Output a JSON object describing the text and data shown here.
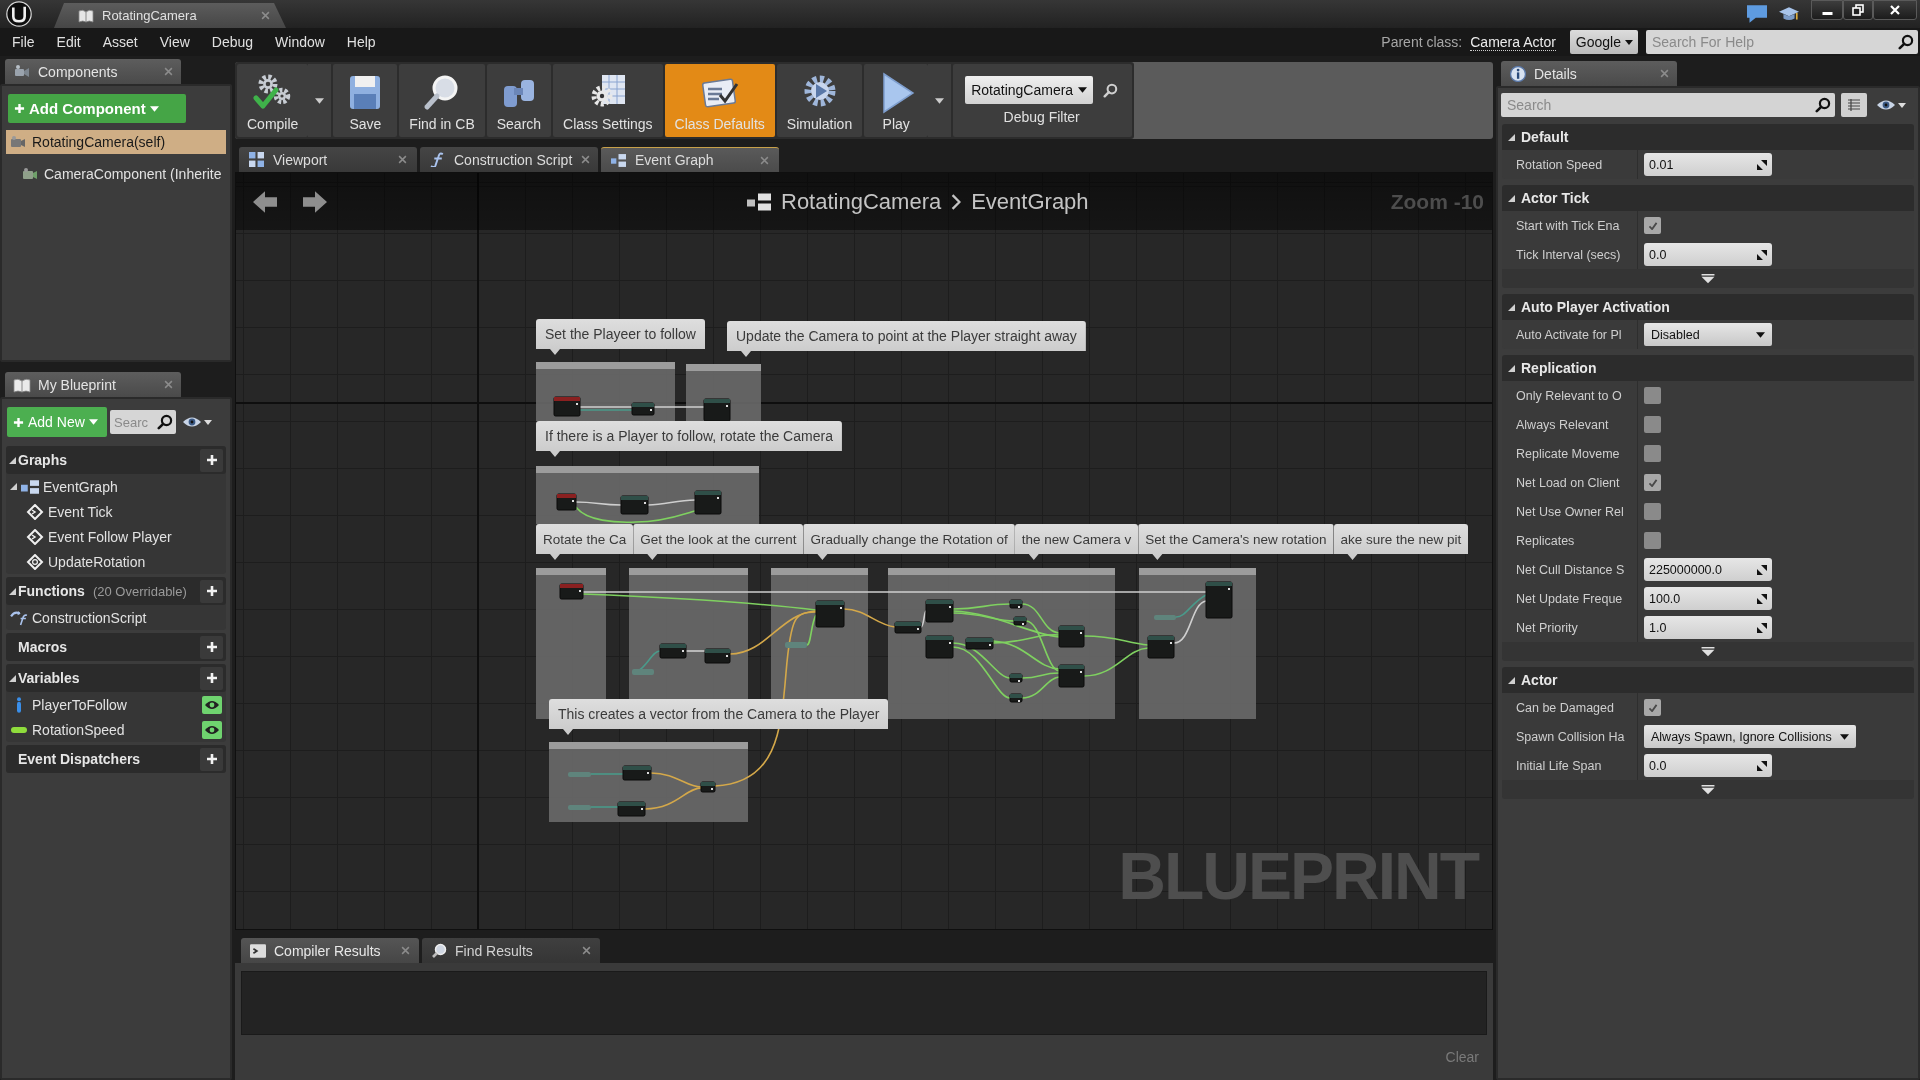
{
  "title_bar": {
    "document_tab": "RotatingCamera"
  },
  "menu_bar": {
    "menus": [
      "File",
      "Edit",
      "Asset",
      "View",
      "Debug",
      "Window",
      "Help"
    ],
    "parent_class_label": "Parent class:",
    "parent_class": "Camera Actor",
    "search_provider": "Google",
    "help_search": {
      "placeholder": "Search For Help"
    }
  },
  "components_panel": {
    "tab": "Components",
    "add_button": "Add Component",
    "items": [
      {
        "label": "RotatingCamera(self)",
        "selected": true
      },
      {
        "label": "CameraComponent (Inherite",
        "selected": false
      }
    ]
  },
  "my_blueprint_panel": {
    "tab": "My Blueprint",
    "add_button": "Add New",
    "search": {
      "placeholder": "Searc"
    },
    "sections": [
      {
        "title": "Graphs",
        "items": [
          {
            "label": "EventGraph",
            "kind": "graph",
            "expanded": true,
            "children": [
              {
                "label": "Event Tick",
                "kind": "event"
              },
              {
                "label": "Event Follow Player",
                "kind": "event"
              },
              {
                "label": "UpdateRotation",
                "kind": "custom_event"
              }
            ]
          }
        ]
      },
      {
        "title": "Functions",
        "note": "(20 Overridable)",
        "items": [
          {
            "label": "ConstructionScript",
            "kind": "function"
          }
        ]
      },
      {
        "title": "Macros"
      },
      {
        "title": "Variables",
        "items": [
          {
            "label": "PlayerToFollow",
            "kind": "object",
            "public": true
          },
          {
            "label": "RotationSpeed",
            "kind": "float",
            "public": true
          }
        ]
      },
      {
        "title": "Event Dispatchers"
      }
    ]
  },
  "toolbar": {
    "buttons": [
      {
        "label": "Compile",
        "selected": false,
        "dropdown": true
      },
      {
        "label": "Save",
        "selected": false,
        "dropdown": false
      },
      {
        "label": "Find in CB",
        "selected": false,
        "dropdown": false
      },
      {
        "label": "Search",
        "selected": false,
        "dropdown": false
      },
      {
        "label": "Class Settings",
        "selected": false,
        "dropdown": false
      },
      {
        "label": "Class Defaults",
        "selected": true,
        "dropdown": false
      },
      {
        "label": "Simulation",
        "selected": false,
        "dropdown": false
      },
      {
        "label": "Play",
        "selected": false,
        "dropdown": true
      }
    ],
    "debug_filter": {
      "value": "RotatingCamera",
      "label": "Debug Filter"
    }
  },
  "editor_tabs": [
    {
      "label": "Viewport",
      "selected": false
    },
    {
      "label": "Construction Script",
      "selected": false
    },
    {
      "label": "Event Graph",
      "selected": true
    }
  ],
  "graph": {
    "breadcrumb": [
      "RotatingCamera",
      "EventGraph"
    ],
    "zoom": "Zoom -10",
    "comments": [
      "Set the Playeer to follow",
      "Update the Camera to point at the Player straight away",
      "If there is a Player to follow, rotate the Camera",
      "Rotate the Ca",
      "Get the look at the current",
      "Gradually change the Rotation of",
      "the new Camera v",
      "Set the Camera's new rotation",
      "ake sure the new pit",
      "This creates a vector from the Camera to the Player"
    ],
    "corner_label": "BLUEPRINT"
  },
  "output_panel": {
    "tabs": [
      {
        "label": "Compiler Results",
        "selected": true
      },
      {
        "label": "Find Results",
        "selected": false
      }
    ],
    "clear_button": {
      "label": "Clear",
      "disabled": true
    }
  },
  "details_panel": {
    "tab": "Details",
    "search": {
      "placeholder": "Search"
    },
    "sections": [
      {
        "title": "Default",
        "advanced": false,
        "rows": [
          {
            "label": "Rotation Speed",
            "kind": "number",
            "value": "0.01"
          }
        ]
      },
      {
        "title": "Actor Tick",
        "advanced": true,
        "rows": [
          {
            "label": "Start with Tick Ena",
            "kind": "checkbox",
            "checked": true
          },
          {
            "label": "Tick Interval (secs)",
            "kind": "number",
            "value": "0.0"
          }
        ]
      },
      {
        "title": "Auto Player Activation",
        "advanced": false,
        "rows": [
          {
            "label": "Auto Activate for Pl",
            "kind": "dropdown",
            "value": "Disabled"
          }
        ]
      },
      {
        "title": "Replication",
        "advanced": true,
        "rows": [
          {
            "label": "Only Relevant to O",
            "kind": "checkbox",
            "checked": false
          },
          {
            "label": "Always Relevant",
            "kind": "checkbox",
            "checked": false
          },
          {
            "label": "Replicate Moveme",
            "kind": "checkbox",
            "checked": false
          },
          {
            "label": "Net Load on Client",
            "kind": "checkbox",
            "checked": true
          },
          {
            "label": "Net Use Owner Rel",
            "kind": "checkbox",
            "checked": false
          },
          {
            "label": "Replicates",
            "kind": "checkbox",
            "checked": false
          },
          {
            "label": "Net Cull Distance S",
            "kind": "number",
            "value": "225000000.0"
          },
          {
            "label": "Net Update Freque",
            "kind": "number",
            "value": "100.0"
          },
          {
            "label": "Net Priority",
            "kind": "number",
            "value": "1.0"
          }
        ]
      },
      {
        "title": "Actor",
        "advanced": true,
        "rows": [
          {
            "label": "Can be Damaged",
            "kind": "checkbox",
            "checked": true
          },
          {
            "label": "Spawn Collision Ha",
            "kind": "dropdown",
            "value": "Always Spawn, Ignore Collisions"
          },
          {
            "label": "Initial Life Span",
            "kind": "number",
            "value": "0.0"
          }
        ]
      }
    ]
  }
}
